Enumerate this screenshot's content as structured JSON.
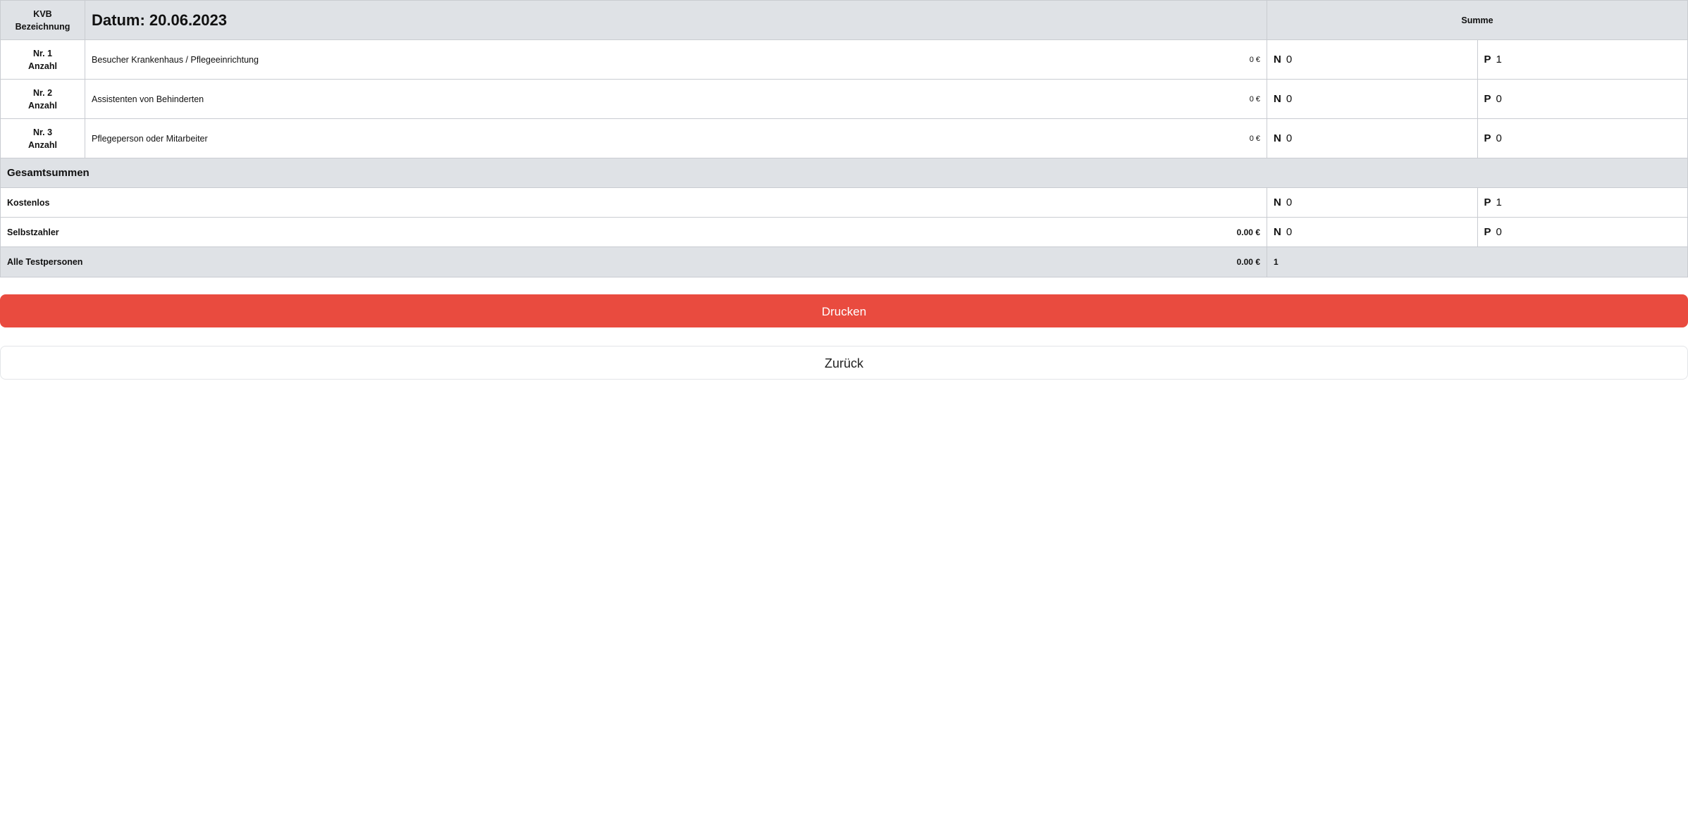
{
  "header": {
    "kvb_line1": "KVB",
    "kvb_line2": "Bezeichnung",
    "date_title": "Datum: 20.06.2023",
    "summe_label": "Summe"
  },
  "rows": [
    {
      "nr": "Nr. 1",
      "anzahl": "Anzahl",
      "desc": "Besucher Krankenhaus / Pflegeeinrichtung",
      "price": "0 €",
      "n_label": "N",
      "n_value": "0",
      "p_label": "P",
      "p_value": "1"
    },
    {
      "nr": "Nr. 2",
      "anzahl": "Anzahl",
      "desc": "Assistenten von Behinderten",
      "price": "0 €",
      "n_label": "N",
      "n_value": "0",
      "p_label": "P",
      "p_value": "0"
    },
    {
      "nr": "Nr. 3",
      "anzahl": "Anzahl",
      "desc": "Pflegeperson oder Mitarbeiter",
      "price": "0 €",
      "n_label": "N",
      "n_value": "0",
      "p_label": "P",
      "p_value": "0"
    }
  ],
  "totals": {
    "section_title": "Gesamtsummen",
    "kostenlos": {
      "label": "Kostenlos",
      "n_label": "N",
      "n_value": "0",
      "p_label": "P",
      "p_value": "1"
    },
    "selbstzahler": {
      "label": "Selbstzahler",
      "amount": "0.00 €",
      "n_label": "N",
      "n_value": "0",
      "p_label": "P",
      "p_value": "0"
    },
    "alle": {
      "label": "Alle Testpersonen",
      "amount": "0.00 €",
      "count": "1"
    }
  },
  "buttons": {
    "print_label": "Drucken",
    "back_label": "Zurück"
  },
  "colors": {
    "header_bg": "#dfe2e6",
    "print_button": "#e94b3f"
  }
}
